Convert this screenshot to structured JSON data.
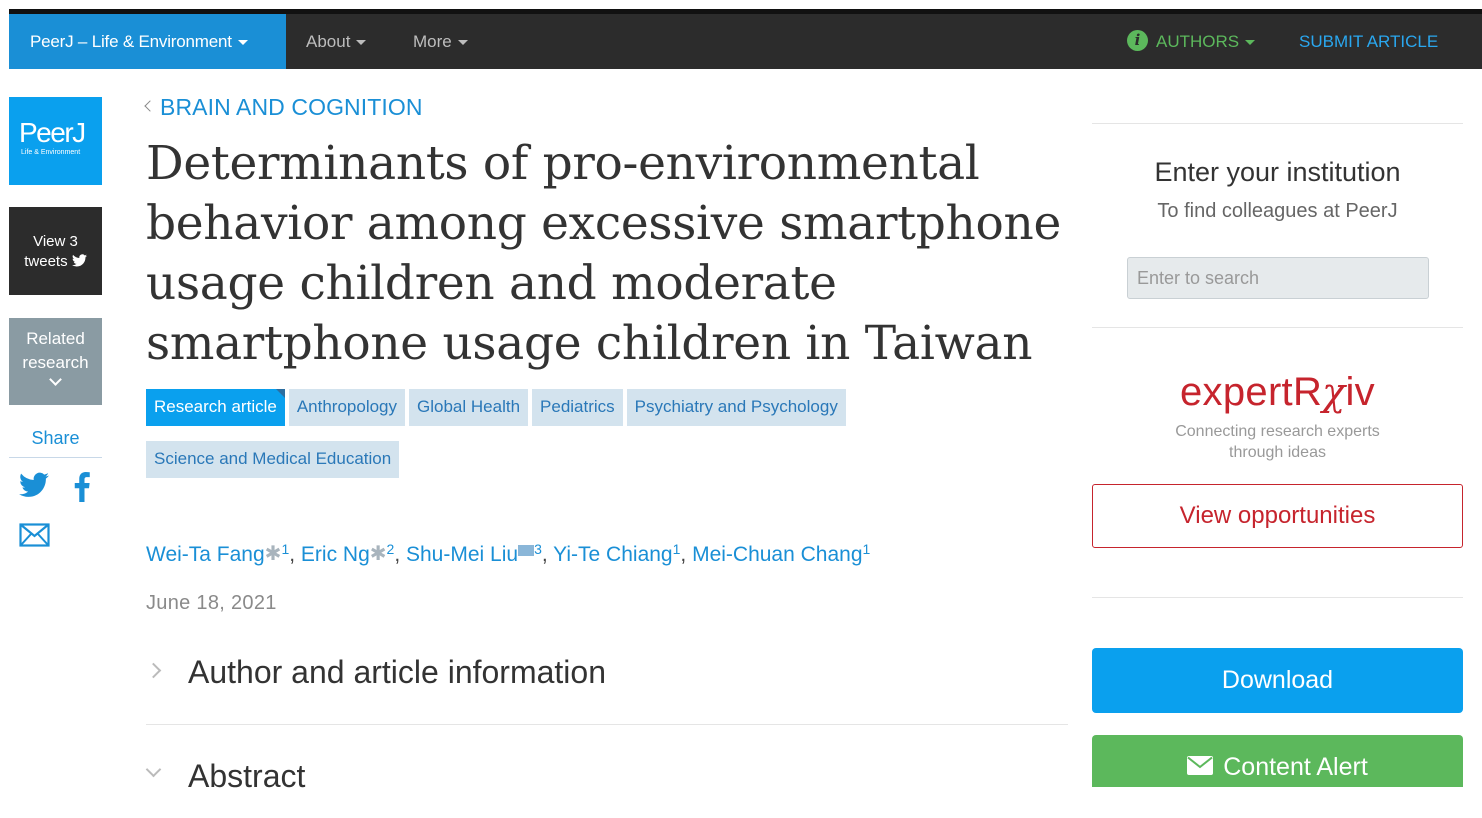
{
  "navbar": {
    "brand": "PeerJ – Life & Environment",
    "about": "About",
    "more": "More",
    "authors": "AUTHORS",
    "submit": "SUBMIT ARTICLE"
  },
  "sidebar": {
    "logo_main": "PeerJ",
    "logo_sub": "Life & Environment",
    "tweets_line1": "View 3",
    "tweets_line2": "tweets",
    "related_line1": "Related",
    "related_line2": "research",
    "share": "Share"
  },
  "article": {
    "breadcrumb": "BRAIN AND COGNITION",
    "title": "Determinants of pro-environmental behavior among excessive smartphone usage children and moderate smartphone usage children in Taiwan",
    "tags": [
      "Research article",
      "Anthropology",
      "Global Health",
      "Pediatrics",
      "Psychiatry and Psychology",
      "Science and Medical Education"
    ],
    "authors": [
      {
        "name": "Wei-Ta Fang",
        "aff": "1"
      },
      {
        "name": "Eric Ng",
        "aff": "2"
      },
      {
        "name": "Shu-Mei Liu",
        "aff": "3"
      },
      {
        "name": "Yi-Te Chiang",
        "aff": "1"
      },
      {
        "name": "Mei-Chuan Chang",
        "aff": "1"
      }
    ],
    "date": "June 18, 2021",
    "sections": {
      "info": "Author and article information",
      "abstract": "Abstract"
    }
  },
  "right": {
    "inst_title": "Enter your institution",
    "inst_sub": "To find colleagues at PeerJ",
    "search_placeholder": "Enter to search",
    "expert_logo_a": "expertR",
    "expert_logo_chi": "χ",
    "expert_logo_b": "iv",
    "expert_tag_line1": "Connecting research experts",
    "expert_tag_line2": "through ideas",
    "view_opportunities": "View opportunities",
    "download": "Download",
    "content_alert": "Content Alert"
  },
  "colors": {
    "brand_blue": "#1a8fd6",
    "accent_blue": "#0aa0ee",
    "nav_dark": "#2c2c2c",
    "green": "#5cb85c",
    "expert_red": "#c6242d"
  }
}
